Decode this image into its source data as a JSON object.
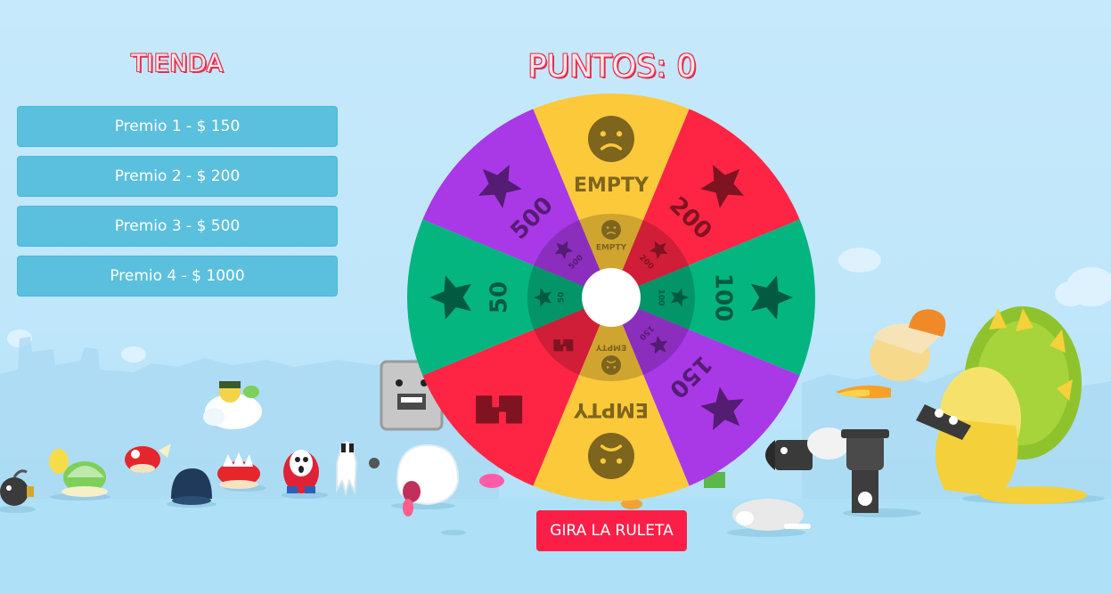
{
  "shop": {
    "title": "TIENDA",
    "prizes": [
      {
        "label": "Premio 1 - $ 150"
      },
      {
        "label": "Premio 2 - $ 200"
      },
      {
        "label": "Premio 3 - $ 500"
      },
      {
        "label": "Premio 4 - $ 1000"
      }
    ]
  },
  "score": {
    "label": "PUNTOS: 0"
  },
  "wheel": {
    "segments": [
      {
        "label": "EMPTY",
        "color": "#fcc93b",
        "icon": "sad-face-icon"
      },
      {
        "label": "200",
        "color": "#fe2544",
        "icon": "star-icon"
      },
      {
        "label": "100",
        "color": "#04b57f",
        "icon": "star-icon"
      },
      {
        "label": "150",
        "color": "#a938e7",
        "icon": "star-icon"
      },
      {
        "label": "EMPTY",
        "color": "#fcc93b",
        "icon": "sad-face-icon"
      },
      {
        "label": "",
        "color": "#fe2544",
        "icon": "bolt-icon"
      },
      {
        "label": "50",
        "color": "#04b57f",
        "icon": "star-icon"
      },
      {
        "label": "500",
        "color": "#a938e7",
        "icon": "star-icon"
      }
    ]
  },
  "spin_button": {
    "label": "GIRA LA RULETA"
  },
  "background": {
    "characters": "mario-characters-illustration"
  }
}
